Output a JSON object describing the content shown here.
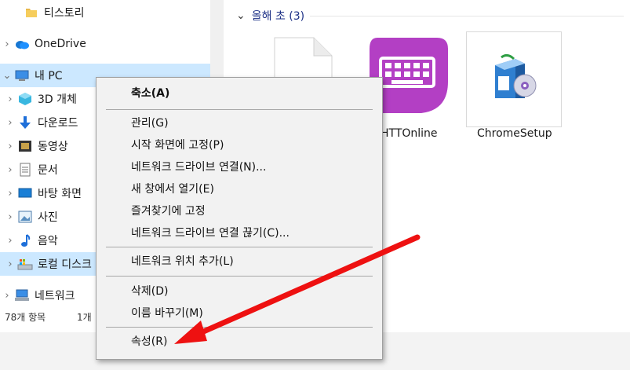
{
  "nav": {
    "items": [
      {
        "label": "티스토리",
        "icon": "folder-icon",
        "chevron": false
      },
      {
        "label": "OneDrive",
        "icon": "onedrive-cloud-icon",
        "chevron": true
      },
      {
        "label": "내 PC",
        "icon": "pc-icon",
        "chevron": true,
        "expanded": true,
        "selected": true
      },
      {
        "label": "3D 개체",
        "icon": "3d-objects-icon",
        "chevron": true
      },
      {
        "label": "다운로드",
        "icon": "download-arrow-icon",
        "chevron": true
      },
      {
        "label": "동영상",
        "icon": "video-icon",
        "chevron": true
      },
      {
        "label": "문서",
        "icon": "document-icon",
        "chevron": true
      },
      {
        "label": "바탕 화면",
        "icon": "desktop-icon",
        "chevron": true
      },
      {
        "label": "사진",
        "icon": "pictures-icon",
        "chevron": true
      },
      {
        "label": "음악",
        "icon": "music-note-icon",
        "chevron": true
      },
      {
        "label": "로컬 디스크",
        "icon": "local-disk-icon",
        "chevron": true,
        "selected": true
      },
      {
        "label": "네트워크",
        "icon": "network-icon",
        "chevron": true
      }
    ]
  },
  "status": {
    "item_count": "78개 항목",
    "selected_count": "1개"
  },
  "content": {
    "group_header": "올해 초 (3)",
    "files": [
      {
        "name": "",
        "icon": "blank-file-icon"
      },
      {
        "name": "HTTOnline",
        "icon": "keyboard-app-icon"
      },
      {
        "name": "ChromeSetup",
        "icon": "installer-box-icon"
      }
    ]
  },
  "context_menu": {
    "items": [
      {
        "label": "축소(A)",
        "bold": true
      },
      {
        "separator": true
      },
      {
        "label": "관리(G)"
      },
      {
        "label": "시작 화면에 고정(P)"
      },
      {
        "label": "네트워크 드라이브 연결(N)..."
      },
      {
        "label": "새 창에서 열기(E)"
      },
      {
        "label": "즐겨찾기에 고정"
      },
      {
        "label": "네트워크 드라이브 연결 끊기(C)..."
      },
      {
        "separator": true
      },
      {
        "label": "네트워크 위치 추가(L)"
      },
      {
        "separator": true
      },
      {
        "label": "삭제(D)"
      },
      {
        "label": "이름 바꾸기(M)"
      },
      {
        "separator": true
      },
      {
        "label": "속성(R)"
      }
    ]
  },
  "colors": {
    "selection": "#cce8ff",
    "menu_bg": "#f2f2f2",
    "arrow": "#ee1111",
    "app_tile": "#b33fc4"
  }
}
